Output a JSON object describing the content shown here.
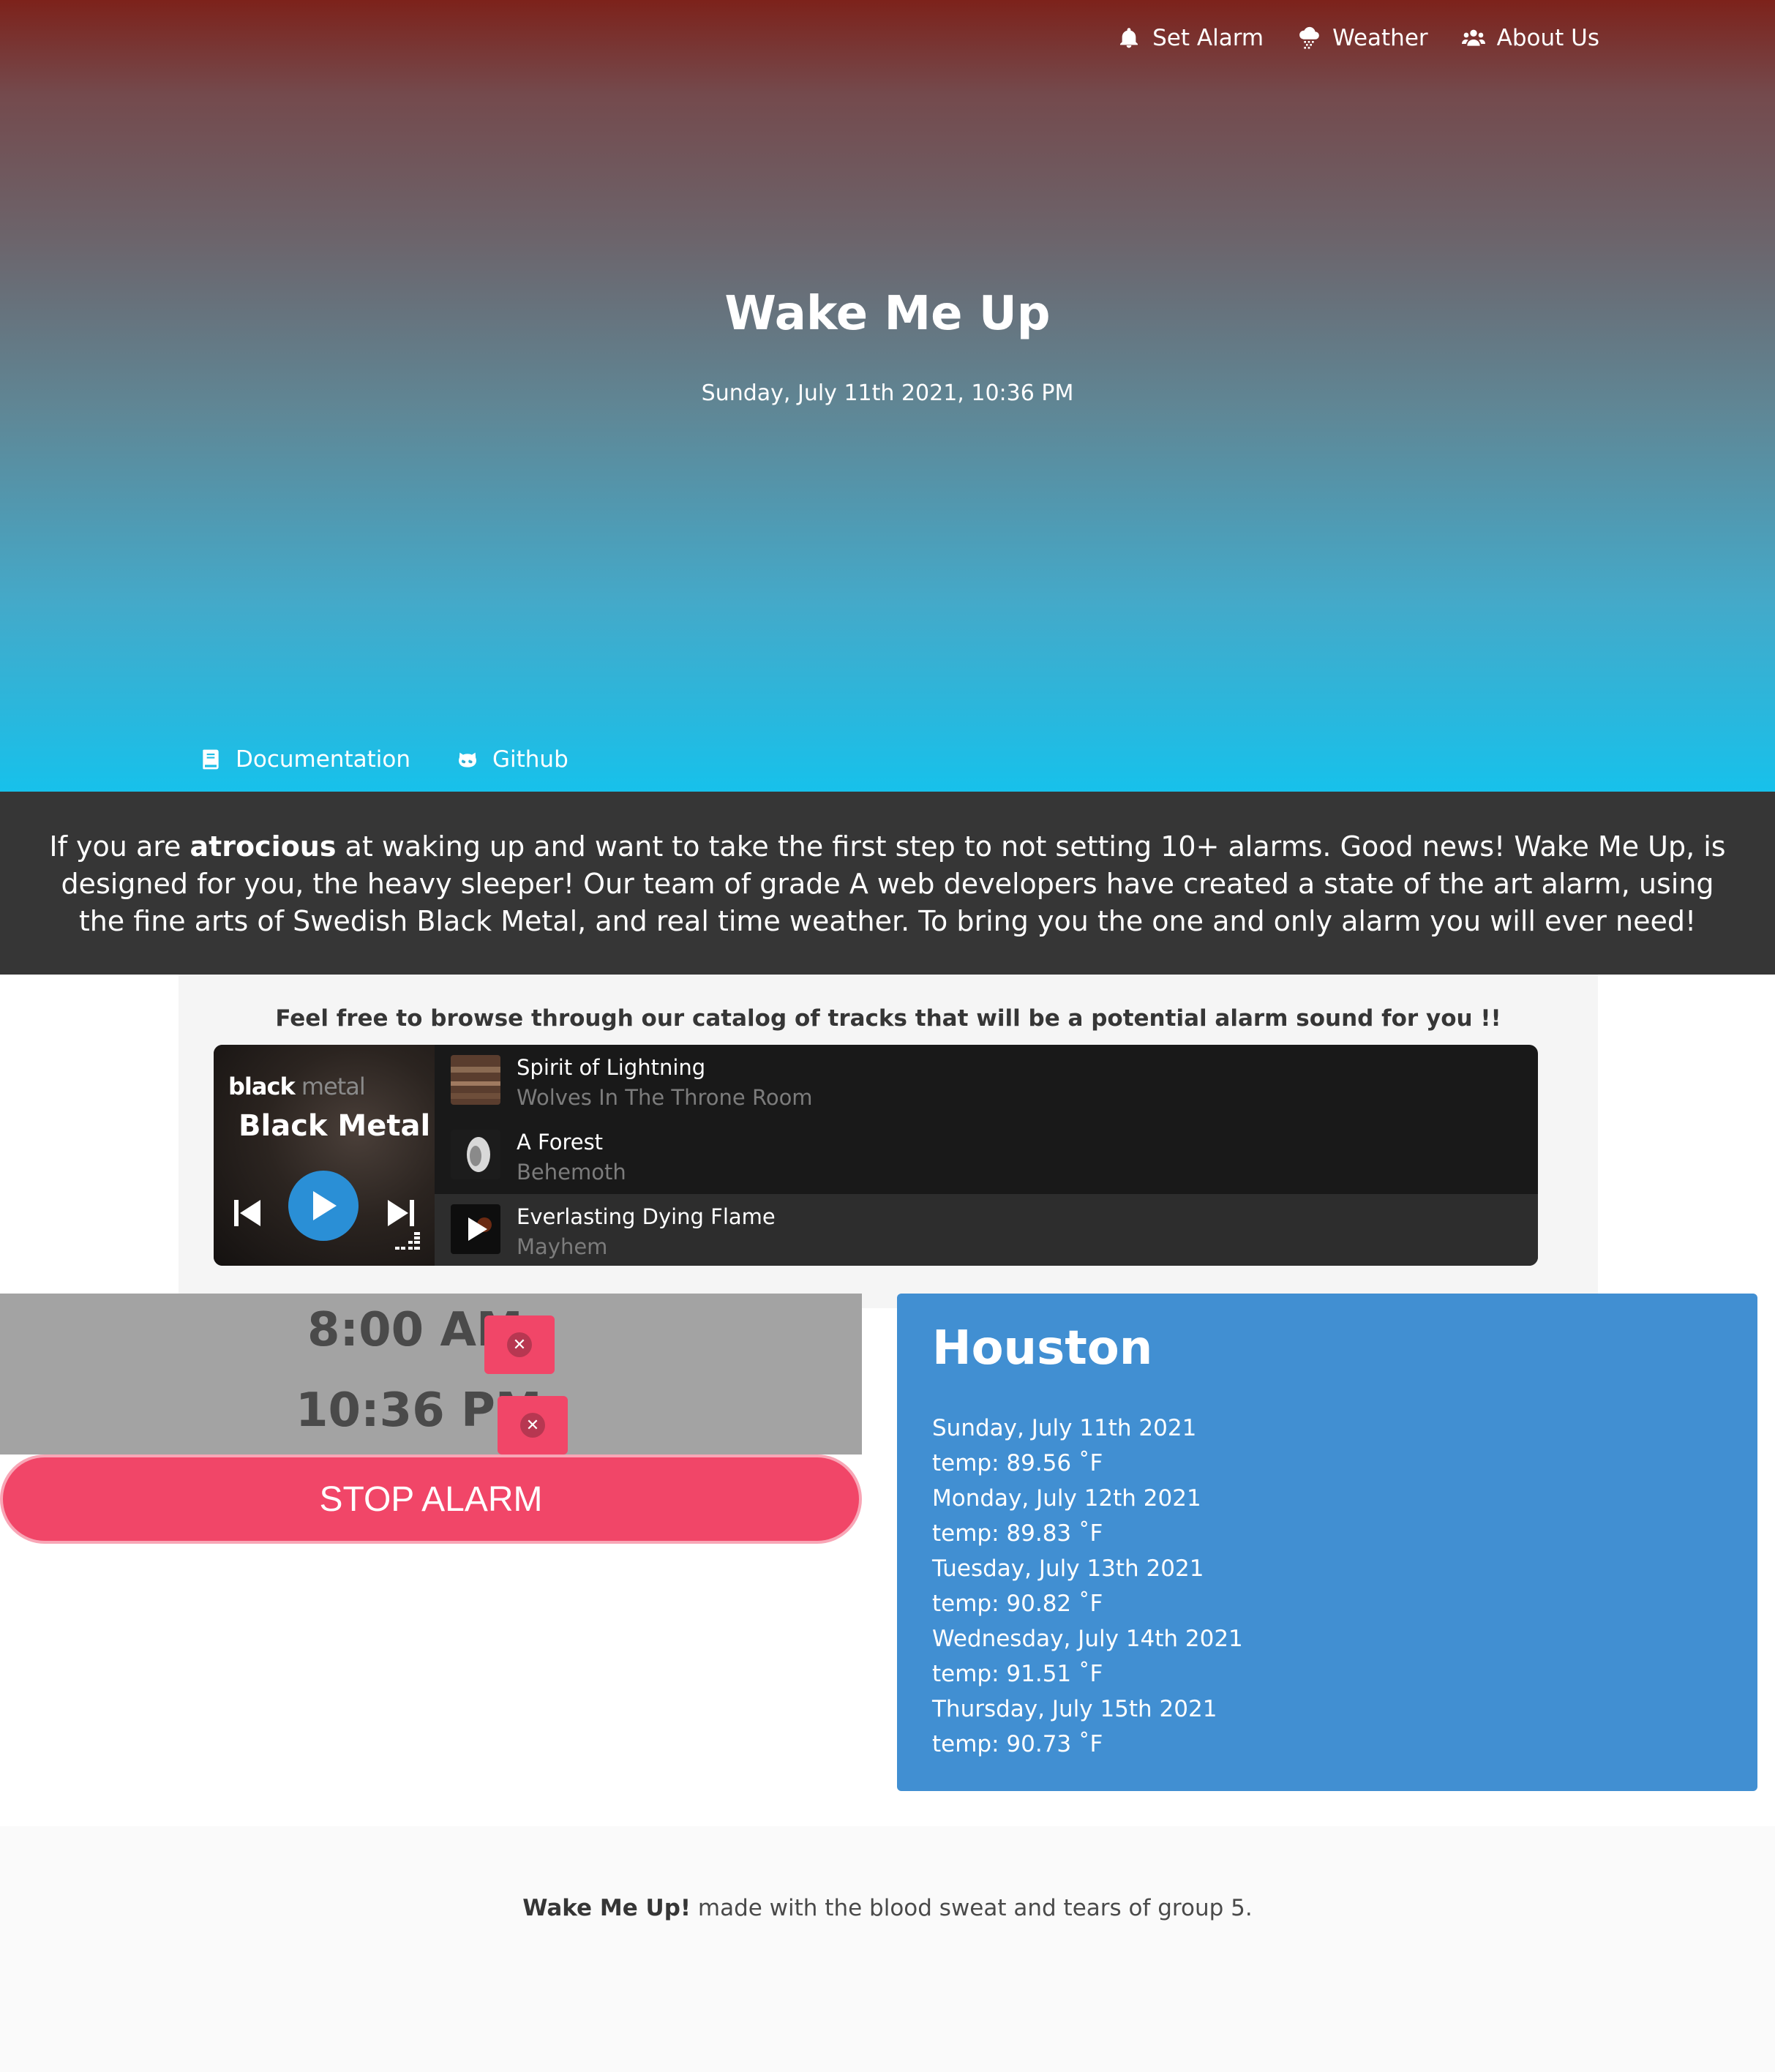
{
  "nav": {
    "items": [
      {
        "label": "Set Alarm",
        "icon": "bell-icon"
      },
      {
        "label": "Weather",
        "icon": "cloud-rain-icon"
      },
      {
        "label": "About Us",
        "icon": "users-icon"
      }
    ]
  },
  "hero": {
    "title": "Wake Me Up",
    "datetime": "Sunday, July 11th 2021, 10:36 PM",
    "links": [
      {
        "label": "Documentation",
        "icon": "book-icon"
      },
      {
        "label": "Github",
        "icon": "github-icon"
      }
    ]
  },
  "intro": {
    "before": "If you are ",
    "bold": "atrocious",
    "after": " at waking up and want to take the first step to not setting 10+ alarms. Good news! Wake Me Up, is designed for you, the heavy sleeper! Our team of grade A web developers have created a state of the art alarm, using the fine arts of Swedish Black Metal, and real time weather. To bring you the one and only alarm you will ever need!"
  },
  "catalog": {
    "heading": "Feel free to browse through our catalog of tracks that will be a potential alarm sound for you !!",
    "player": {
      "brand_bold": "black",
      "brand_light": " metal",
      "playlist_title": "Black Metal",
      "tracks": [
        {
          "title": "Spirit of Lightning",
          "artist": "Wolves In The Throne Room"
        },
        {
          "title": "A Forest",
          "artist": "Behemoth"
        },
        {
          "title": "Everlasting Dying Flame",
          "artist": "Mayhem"
        }
      ]
    }
  },
  "alarms": {
    "items": [
      {
        "time": "8:00 AM"
      },
      {
        "time": "10:36 PM"
      }
    ],
    "stop_label": "STOP ALARM"
  },
  "weather": {
    "city": "Houston",
    "days": [
      {
        "date": "Sunday, July 11th 2021",
        "temp": "temp: 89.56 ˚F"
      },
      {
        "date": "Monday, July 12th 2021",
        "temp": "temp: 89.83 ˚F"
      },
      {
        "date": "Tuesday, July 13th 2021",
        "temp": "temp: 90.82 ˚F"
      },
      {
        "date": "Wednesday, July 14th 2021",
        "temp": "temp: 91.51 ˚F"
      },
      {
        "date": "Thursday, July 15th 2021",
        "temp": "temp: 90.73 ˚F"
      }
    ]
  },
  "footer": {
    "bold": "Wake Me Up!",
    "text": " made with the blood sweat and tears of group 5."
  },
  "colors": {
    "accent_pink": "#f14668",
    "weather_blue": "#418fd2",
    "intro_bg": "#363636",
    "play_blue": "#2a8fd6"
  }
}
